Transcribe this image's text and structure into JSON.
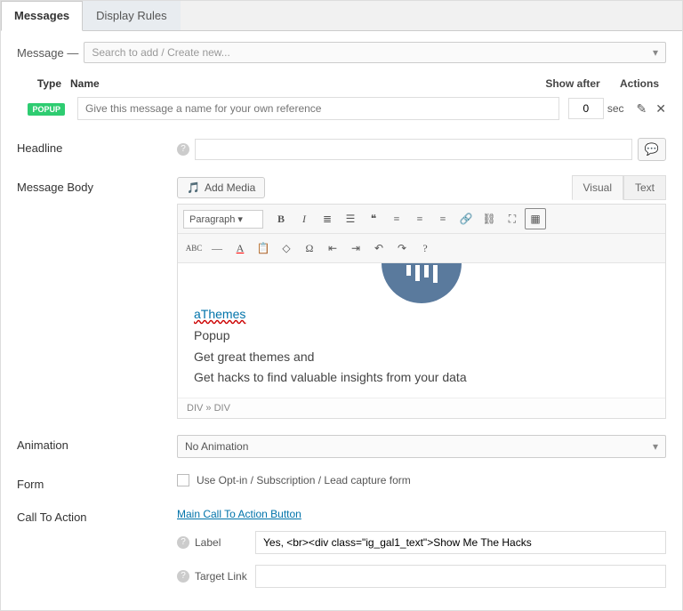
{
  "tabs": {
    "messages": "Messages",
    "display_rules": "Display Rules"
  },
  "message_row": {
    "label": "Message —",
    "placeholder": "Search to add / Create new..."
  },
  "headers": {
    "type": "Type",
    "name": "Name",
    "show_after": "Show after",
    "actions": "Actions"
  },
  "row": {
    "badge": "POPUP",
    "name_placeholder": "Give this message a name for your own reference",
    "show_after_value": "0",
    "sec": "sec"
  },
  "labels": {
    "headline": "Headline",
    "message_body": "Message Body",
    "animation": "Animation",
    "form": "Form",
    "cta": "Call To Action"
  },
  "editor": {
    "add_media": "Add Media",
    "tab_visual": "Visual",
    "tab_text": "Text",
    "paragraph": "Paragraph",
    "status": "DIV » DIV",
    "content": {
      "line1": "aThemes",
      "line2": "Popup",
      "line3": "Get great themes and",
      "line4": "Get hacks to find valuable insights from your data"
    }
  },
  "animation_value": "No Animation",
  "form_checkbox": "Use Opt-in / Subscription / Lead capture form",
  "cta": {
    "main_link": "Main Call To Action Button",
    "label_label": "Label",
    "label_value": "Yes, <br><div class=\"ig_gal1_text\">Show Me The Hacks",
    "target_label": "Target Link"
  }
}
